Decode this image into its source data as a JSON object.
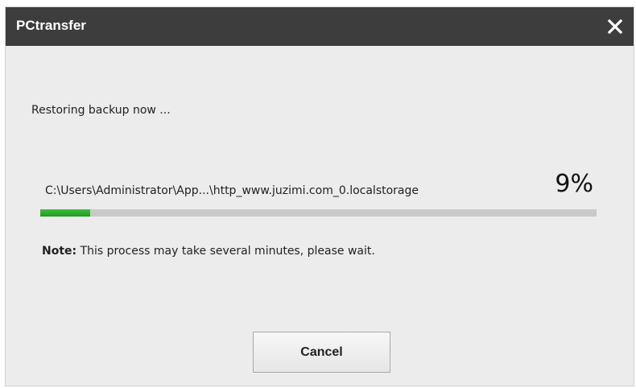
{
  "window": {
    "title": "PCtransfer",
    "close_icon": "close-icon"
  },
  "status": {
    "message": "Restoring backup now ...",
    "file_path": "C:\\Users\\Administrator\\App...\\http_www.juzimi.com_0.localstorage",
    "percent_label": "9%",
    "progress_percent": 9
  },
  "note": {
    "label": "Note:",
    "text": " This process may take several minutes, please wait."
  },
  "actions": {
    "cancel_label": "Cancel"
  },
  "colors": {
    "titlebar": "#3d3d3d",
    "background": "#ececec",
    "progress_fill": "#2aa82a",
    "progress_track": "#c9c9c9"
  }
}
